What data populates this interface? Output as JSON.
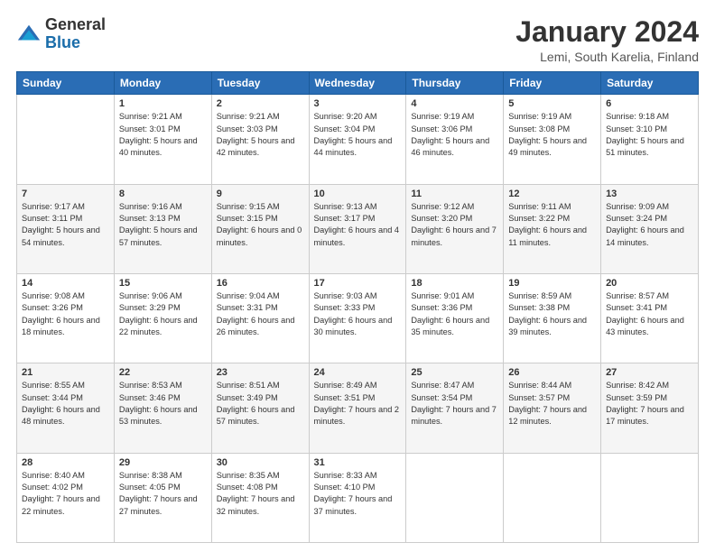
{
  "header": {
    "logo": {
      "general": "General",
      "blue": "Blue"
    },
    "title": "January 2024",
    "location": "Lemi, South Karelia, Finland"
  },
  "weekdays": [
    "Sunday",
    "Monday",
    "Tuesday",
    "Wednesday",
    "Thursday",
    "Friday",
    "Saturday"
  ],
  "weeks": [
    [
      {
        "day": "",
        "sunrise": "",
        "sunset": "",
        "daylight": ""
      },
      {
        "day": "1",
        "sunrise": "Sunrise: 9:21 AM",
        "sunset": "Sunset: 3:01 PM",
        "daylight": "Daylight: 5 hours and 40 minutes."
      },
      {
        "day": "2",
        "sunrise": "Sunrise: 9:21 AM",
        "sunset": "Sunset: 3:03 PM",
        "daylight": "Daylight: 5 hours and 42 minutes."
      },
      {
        "day": "3",
        "sunrise": "Sunrise: 9:20 AM",
        "sunset": "Sunset: 3:04 PM",
        "daylight": "Daylight: 5 hours and 44 minutes."
      },
      {
        "day": "4",
        "sunrise": "Sunrise: 9:19 AM",
        "sunset": "Sunset: 3:06 PM",
        "daylight": "Daylight: 5 hours and 46 minutes."
      },
      {
        "day": "5",
        "sunrise": "Sunrise: 9:19 AM",
        "sunset": "Sunset: 3:08 PM",
        "daylight": "Daylight: 5 hours and 49 minutes."
      },
      {
        "day": "6",
        "sunrise": "Sunrise: 9:18 AM",
        "sunset": "Sunset: 3:10 PM",
        "daylight": "Daylight: 5 hours and 51 minutes."
      }
    ],
    [
      {
        "day": "7",
        "sunrise": "Sunrise: 9:17 AM",
        "sunset": "Sunset: 3:11 PM",
        "daylight": "Daylight: 5 hours and 54 minutes."
      },
      {
        "day": "8",
        "sunrise": "Sunrise: 9:16 AM",
        "sunset": "Sunset: 3:13 PM",
        "daylight": "Daylight: 5 hours and 57 minutes."
      },
      {
        "day": "9",
        "sunrise": "Sunrise: 9:15 AM",
        "sunset": "Sunset: 3:15 PM",
        "daylight": "Daylight: 6 hours and 0 minutes."
      },
      {
        "day": "10",
        "sunrise": "Sunrise: 9:13 AM",
        "sunset": "Sunset: 3:17 PM",
        "daylight": "Daylight: 6 hours and 4 minutes."
      },
      {
        "day": "11",
        "sunrise": "Sunrise: 9:12 AM",
        "sunset": "Sunset: 3:20 PM",
        "daylight": "Daylight: 6 hours and 7 minutes."
      },
      {
        "day": "12",
        "sunrise": "Sunrise: 9:11 AM",
        "sunset": "Sunset: 3:22 PM",
        "daylight": "Daylight: 6 hours and 11 minutes."
      },
      {
        "day": "13",
        "sunrise": "Sunrise: 9:09 AM",
        "sunset": "Sunset: 3:24 PM",
        "daylight": "Daylight: 6 hours and 14 minutes."
      }
    ],
    [
      {
        "day": "14",
        "sunrise": "Sunrise: 9:08 AM",
        "sunset": "Sunset: 3:26 PM",
        "daylight": "Daylight: 6 hours and 18 minutes."
      },
      {
        "day": "15",
        "sunrise": "Sunrise: 9:06 AM",
        "sunset": "Sunset: 3:29 PM",
        "daylight": "Daylight: 6 hours and 22 minutes."
      },
      {
        "day": "16",
        "sunrise": "Sunrise: 9:04 AM",
        "sunset": "Sunset: 3:31 PM",
        "daylight": "Daylight: 6 hours and 26 minutes."
      },
      {
        "day": "17",
        "sunrise": "Sunrise: 9:03 AM",
        "sunset": "Sunset: 3:33 PM",
        "daylight": "Daylight: 6 hours and 30 minutes."
      },
      {
        "day": "18",
        "sunrise": "Sunrise: 9:01 AM",
        "sunset": "Sunset: 3:36 PM",
        "daylight": "Daylight: 6 hours and 35 minutes."
      },
      {
        "day": "19",
        "sunrise": "Sunrise: 8:59 AM",
        "sunset": "Sunset: 3:38 PM",
        "daylight": "Daylight: 6 hours and 39 minutes."
      },
      {
        "day": "20",
        "sunrise": "Sunrise: 8:57 AM",
        "sunset": "Sunset: 3:41 PM",
        "daylight": "Daylight: 6 hours and 43 minutes."
      }
    ],
    [
      {
        "day": "21",
        "sunrise": "Sunrise: 8:55 AM",
        "sunset": "Sunset: 3:44 PM",
        "daylight": "Daylight: 6 hours and 48 minutes."
      },
      {
        "day": "22",
        "sunrise": "Sunrise: 8:53 AM",
        "sunset": "Sunset: 3:46 PM",
        "daylight": "Daylight: 6 hours and 53 minutes."
      },
      {
        "day": "23",
        "sunrise": "Sunrise: 8:51 AM",
        "sunset": "Sunset: 3:49 PM",
        "daylight": "Daylight: 6 hours and 57 minutes."
      },
      {
        "day": "24",
        "sunrise": "Sunrise: 8:49 AM",
        "sunset": "Sunset: 3:51 PM",
        "daylight": "Daylight: 7 hours and 2 minutes."
      },
      {
        "day": "25",
        "sunrise": "Sunrise: 8:47 AM",
        "sunset": "Sunset: 3:54 PM",
        "daylight": "Daylight: 7 hours and 7 minutes."
      },
      {
        "day": "26",
        "sunrise": "Sunrise: 8:44 AM",
        "sunset": "Sunset: 3:57 PM",
        "daylight": "Daylight: 7 hours and 12 minutes."
      },
      {
        "day": "27",
        "sunrise": "Sunrise: 8:42 AM",
        "sunset": "Sunset: 3:59 PM",
        "daylight": "Daylight: 7 hours and 17 minutes."
      }
    ],
    [
      {
        "day": "28",
        "sunrise": "Sunrise: 8:40 AM",
        "sunset": "Sunset: 4:02 PM",
        "daylight": "Daylight: 7 hours and 22 minutes."
      },
      {
        "day": "29",
        "sunrise": "Sunrise: 8:38 AM",
        "sunset": "Sunset: 4:05 PM",
        "daylight": "Daylight: 7 hours and 27 minutes."
      },
      {
        "day": "30",
        "sunrise": "Sunrise: 8:35 AM",
        "sunset": "Sunset: 4:08 PM",
        "daylight": "Daylight: 7 hours and 32 minutes."
      },
      {
        "day": "31",
        "sunrise": "Sunrise: 8:33 AM",
        "sunset": "Sunset: 4:10 PM",
        "daylight": "Daylight: 7 hours and 37 minutes."
      },
      {
        "day": "",
        "sunrise": "",
        "sunset": "",
        "daylight": ""
      },
      {
        "day": "",
        "sunrise": "",
        "sunset": "",
        "daylight": ""
      },
      {
        "day": "",
        "sunrise": "",
        "sunset": "",
        "daylight": ""
      }
    ]
  ]
}
